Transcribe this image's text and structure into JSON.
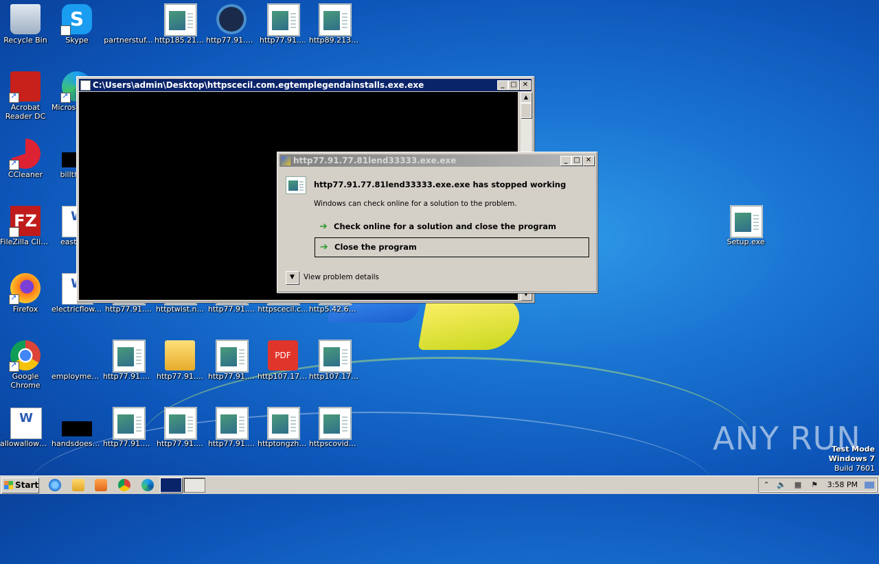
{
  "desktop": {
    "icons": [
      {
        "label": "Recycle Bin",
        "icon": "recycle-bin-icon"
      },
      {
        "label": "Skype",
        "icon": "skype-icon"
      },
      {
        "label": "partnerstuf...",
        "icon": "document-icon"
      },
      {
        "label": "http185.21....",
        "icon": "exe-icon"
      },
      {
        "label": "http77.91.7...",
        "icon": "round-app-icon"
      },
      {
        "label": "http77.91....",
        "icon": "exe-icon"
      },
      {
        "label": "http89.213....",
        "icon": "exe-icon"
      },
      {
        "label": "Acrobat Reader DC",
        "icon": "acrobat-icon"
      },
      {
        "label": "Microsoft Edge",
        "icon": "edge-icon"
      },
      {
        "label": "CCleaner",
        "icon": "ccleaner-icon"
      },
      {
        "label": "billthre...",
        "icon": "black-file-icon"
      },
      {
        "label": "FileZilla Client",
        "icon": "filezilla-icon"
      },
      {
        "label": "eastph...",
        "icon": "word-doc-icon"
      },
      {
        "label": "Setup.exe",
        "icon": "exe-icon"
      },
      {
        "label": "Firefox",
        "icon": "firefox-icon"
      },
      {
        "label": "electricflow.rtf",
        "icon": "word-doc-icon"
      },
      {
        "label": "http77.91....",
        "icon": "exe-icon"
      },
      {
        "label": "httptwist.n...",
        "icon": "exe-icon"
      },
      {
        "label": "http77.91....",
        "icon": "exe-icon"
      },
      {
        "label": "httpscecil.c...",
        "icon": "exe-icon"
      },
      {
        "label": "http5.42.65....",
        "icon": "exe-icon"
      },
      {
        "label": "Google Chrome",
        "icon": "chrome-icon"
      },
      {
        "label": "employment...",
        "icon": "document-icon"
      },
      {
        "label": "http77.91.7...",
        "icon": "exe-icon"
      },
      {
        "label": "http77.91....",
        "icon": "folder-icon"
      },
      {
        "label": "http77.91....",
        "icon": "exe-icon"
      },
      {
        "label": "http107.17....",
        "icon": "pdf-icon"
      },
      {
        "label": "http107.17....",
        "icon": "exe-icon"
      },
      {
        "label": "allowallowe...",
        "icon": "word-doc-icon"
      },
      {
        "label": "handsdoes.jpg",
        "icon": "black-file-icon"
      },
      {
        "label": "http77.91.7...",
        "icon": "exe-icon"
      },
      {
        "label": "http77.91....",
        "icon": "exe-icon"
      },
      {
        "label": "http77.91....",
        "icon": "exe-icon"
      },
      {
        "label": "httptongzhi....",
        "icon": "exe-icon"
      },
      {
        "label": "httpscovid1....",
        "icon": "exe-icon"
      }
    ]
  },
  "console": {
    "title": "C:\\Users\\admin\\Desktop\\httpscecil.com.egtemplegendainstalls.exe.exe"
  },
  "dialog": {
    "title": "http77.91.77.81lend33333.exe.exe",
    "heading": "http77.91.77.81lend33333.exe.exe has stopped working",
    "subtext": "Windows can check online for a solution to the problem.",
    "option_check": "Check online for a solution and close the program",
    "option_close": "Close the program",
    "details": "View problem details"
  },
  "taskbar": {
    "start": "Start",
    "clock": "3:58 PM"
  },
  "watermark": "ANY RUN",
  "testmode": {
    "line1": "Test Mode",
    "line2": "Windows 7",
    "line3": "Build 7601"
  },
  "colors": {
    "desktop": "#1a74d2",
    "titlebar_active": "#0a246a",
    "titlebar_inactive": "#808080",
    "window_face": "#d4d0c8",
    "option_arrow": "#2a9a2a"
  }
}
